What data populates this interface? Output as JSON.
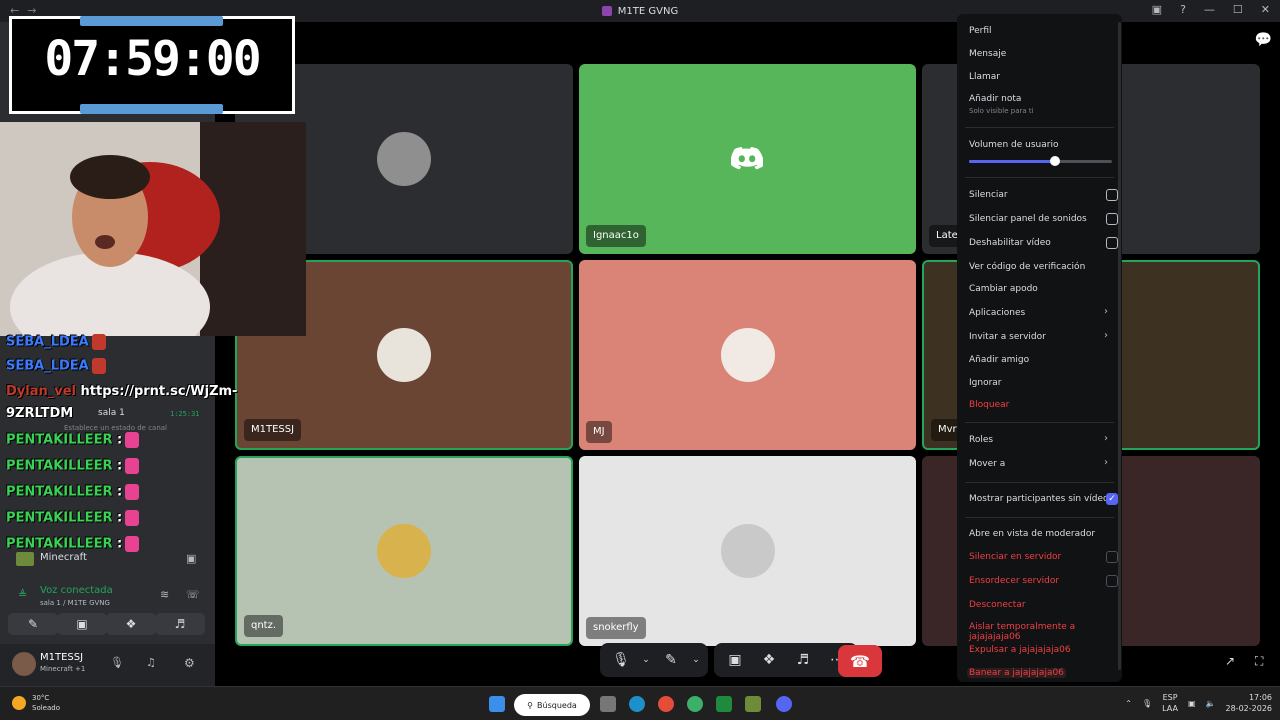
{
  "window": {
    "title": "M1TE GVNG"
  },
  "timer": {
    "time": "07:59:00"
  },
  "tiles": [
    {
      "name": "",
      "bg": "#2b2d31"
    },
    {
      "name": "Ignaac1o",
      "bg": "#57b55a"
    },
    {
      "name": "Late",
      "bg": "#2b2d31"
    },
    {
      "name": "M1TESSJ",
      "bg": "#6b4534"
    },
    {
      "name": "MJ",
      "bg": "#d98476"
    },
    {
      "name": "Mvrt",
      "bg": "#3d3222"
    },
    {
      "name": "qntz.",
      "bg": "#b6c3b3"
    },
    {
      "name": "snokerfly",
      "bg": "#e5e5e6"
    },
    {
      "name": "",
      "bg": "#3a2626"
    }
  ],
  "chat": {
    "lines": [
      {
        "user": "SEBA_LDEA",
        "text": ""
      },
      {
        "user": "SEBA_LDEA",
        "text": ""
      },
      {
        "user": "Dylan_vel",
        "text": "https://prnt.sc/WjZm-"
      },
      {
        "user": "9ZRLTDM",
        "text": ""
      },
      {
        "user": "PENTAKILLEER",
        "text": ":"
      },
      {
        "user": "PENTAKILLEER",
        "text": ":"
      },
      {
        "user": "PENTAKILLEER",
        "text": ":"
      },
      {
        "user": "PENTAKILLEER",
        "text": ":"
      },
      {
        "user": "PENTAKILLEER",
        "text": ":"
      }
    ]
  },
  "left_panel": {
    "channel": "sala 1",
    "channel_time": "1:25:31",
    "status_hint": "Establece un estado de canal",
    "activity": "Minecraft",
    "voice_status": "Voz conectada",
    "voice_location": "sala 1 / M1TE GVNG",
    "user_name": "M1TESSJ",
    "user_activity": "Minecraft +1"
  },
  "context_menu": {
    "perfil": "Perfil",
    "mensaje": "Mensaje",
    "llamar": "Llamar",
    "nota": "Añadir nota",
    "nota_hint": "Solo visible para ti",
    "volumen": "Volumen de usuario",
    "volume_level": 0.6,
    "silenciar": "Silenciar",
    "silenciar_sonidos": "Silenciar panel de sonidos",
    "deshabilitar_video": "Deshabilitar vídeo",
    "codigo": "Ver código de verificación",
    "apodo": "Cambiar apodo",
    "aplicaciones": "Aplicaciones",
    "invitar": "Invitar a servidor",
    "amigo": "Añadir amigo",
    "ignorar": "Ignorar",
    "bloquear": "Bloquear",
    "roles": "Roles",
    "mover": "Mover a",
    "mostrar_sin_video": "Mostrar participantes sin vídeo",
    "moderador": "Abre en vista de moderador",
    "silenciar_servidor": "Silenciar en servidor",
    "ensordecer": "Ensordecer servidor",
    "desconectar": "Desconectar",
    "aislar": "Aislar temporalmente a jajajajaja06",
    "expulsar": "Expulsar a jajajajaja06",
    "banear": "Banear a jajajajaja06"
  },
  "taskbar": {
    "temp": "30°C",
    "weather": "Soleado",
    "search": "Búsqueda",
    "lang1": "ESP",
    "lang2": "LAA",
    "time": "17:06",
    "date": "28-02-2026"
  },
  "colors": {
    "danger": "#f23f43",
    "accent": "#5865f2",
    "hangup": "#da373c"
  }
}
